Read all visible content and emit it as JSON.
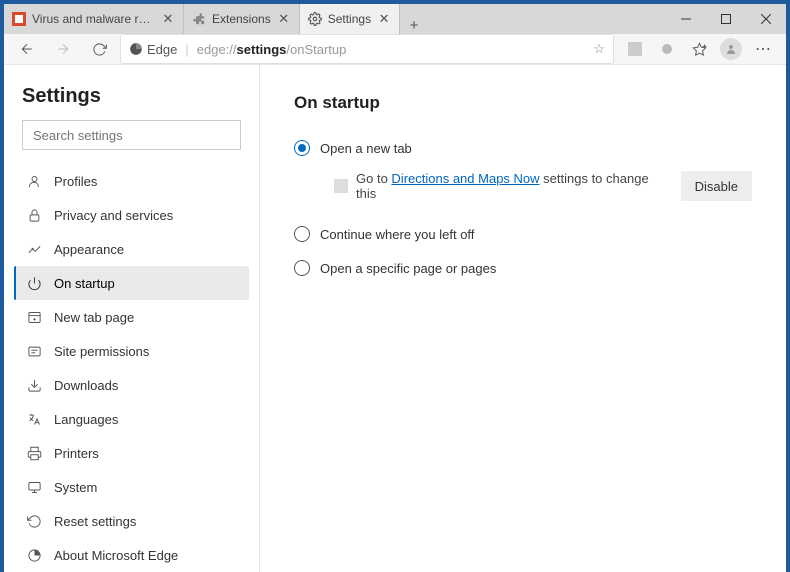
{
  "window": {
    "tabs": [
      {
        "label": "Virus and malware removal instr",
        "favicon": "pcrisk"
      },
      {
        "label": "Extensions",
        "favicon": "extensions"
      },
      {
        "label": "Settings",
        "favicon": "gear"
      }
    ],
    "active_tab_index": 2
  },
  "addressbar": {
    "brand": "Edge",
    "url_dim_prefix": "edge://",
    "url_bold": "settings",
    "url_dim_suffix": "/onStartup"
  },
  "sidebar": {
    "title": "Settings",
    "search_placeholder": "Search settings",
    "items": [
      {
        "label": "Profiles",
        "icon": "person"
      },
      {
        "label": "Privacy and services",
        "icon": "lock"
      },
      {
        "label": "Appearance",
        "icon": "appearance"
      },
      {
        "label": "On startup",
        "icon": "power"
      },
      {
        "label": "New tab page",
        "icon": "newtab"
      },
      {
        "label": "Site permissions",
        "icon": "permissions"
      },
      {
        "label": "Downloads",
        "icon": "download"
      },
      {
        "label": "Languages",
        "icon": "language"
      },
      {
        "label": "Printers",
        "icon": "printer"
      },
      {
        "label": "System",
        "icon": "system"
      },
      {
        "label": "Reset settings",
        "icon": "reset"
      },
      {
        "label": "About Microsoft Edge",
        "icon": "edge"
      }
    ],
    "active_index": 3
  },
  "main": {
    "heading": "On startup",
    "radios": [
      {
        "label": "Open a new tab"
      },
      {
        "label": "Continue where you left off"
      },
      {
        "label": "Open a specific page or pages"
      }
    ],
    "selected_radio": 0,
    "extension_notice": {
      "prefix": "Go to ",
      "link": "Directions and Maps Now",
      "suffix": " settings to change this",
      "button": "Disable"
    }
  }
}
